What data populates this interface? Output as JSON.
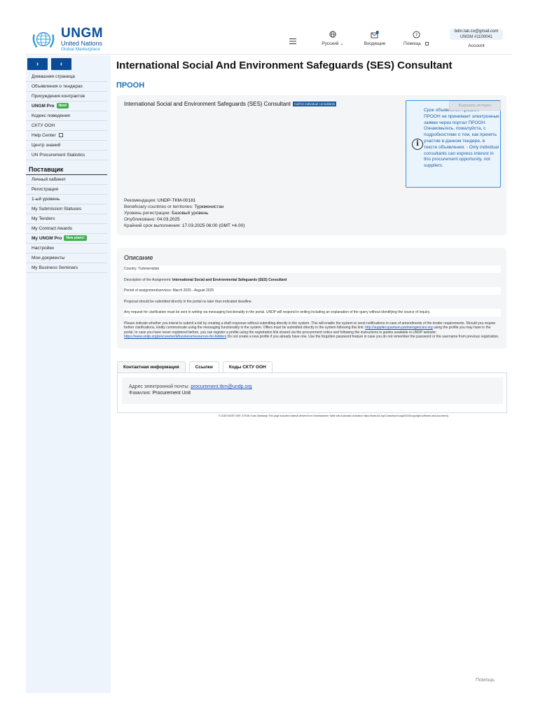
{
  "header": {
    "logo": {
      "title": "UNGM",
      "line1": "United Nations",
      "line2": "Global Marketplace"
    },
    "language_label": "Русский",
    "inbox_label": "Входящие",
    "help_label": "Помощь",
    "account_email": "bdm.tak.co@gmail.com",
    "account_id": "UNGM #1100041",
    "account_label": "Account"
  },
  "sidebar": {
    "items": [
      "Домашняя страница",
      "Объявления о тендерах",
      "Присуждения контрактов"
    ],
    "ungm_pro": "UNGM Pro",
    "new_badge": "New!",
    "items2": [
      "Кодекс поведения",
      "СКТУ ООН"
    ],
    "help_center": "Help Center",
    "items3": [
      "Центр знаний",
      "UN Procurement Statistics"
    ],
    "supplier_heading": "Поставщик",
    "supplier_items": [
      "Личный кабинет",
      "Регистрация",
      "1-ый уровень",
      "My Submission Statuses",
      "My Tenders",
      "My Contract Awards"
    ],
    "my_ungm_pro": "My UNGM Pro",
    "new_plans_badge": "New plans!",
    "supplier_items2": [
      "Настройки",
      "Мои документы",
      "My Business Seminars"
    ]
  },
  "main": {
    "title": "International Social And Environment Safeguards (SES) Consultant",
    "agency": "ПРООН",
    "card1": {
      "title": "International Social and Environment Safeguards (SES) Consultant",
      "tag": "Call for individual consultants",
      "express_button": "Выразить интерес",
      "notice": "Срок объявления прошел. - ПРООН не принимает электронные заявки через портал ПРООН. Ознакомьтесь, пожалуйста, с подробностями о том, как принять участие в данном тендере, в тексте объявления. - Only individual consultants can express interest in this procurement opportunity, not suppliers.",
      "ref_label": "Рекомендация:",
      "ref_value": "UNDP-TKM-00181",
      "countries_label": "Beneficiary countries or territories:",
      "countries_value": "Туркменистан",
      "level_label": "Уровень регистрации:",
      "level_value": "Базовый уровень",
      "published_label": "Опубликовано:",
      "published_value": "04.03.2025",
      "deadline_label": "Крайний срок выполнения:",
      "deadline_value": "17.03.2025 06:00 (GMT +4.00)"
    },
    "card2": {
      "title": "Описание",
      "country": "Country:   Turkmenistan",
      "assignment_label": "Description of the Assignment:",
      "assignment_value": "International Social and Environmental Safeguards (SES) Consultant",
      "period": "Period of assignment/services: March 2025 - August 2025",
      "proposal": "Proposal should be submitted directly in the portal no later than indicated deadline.",
      "clarification": "Any request for clarification must be sent in writing via messaging functionality in the portal. UNDP will respond in writing including an explanation of the query without identifying the source of inquiry.",
      "para1": "Please indicate whether you intend to submit a bid by creating a draft response without submitting directly in the system. This will enable the system to send notifications in case of amendments of the tender requirements. Should you require further clarifications, kindly communicate using the messaging functionality in the system. Offers must be submitted directly in the system following this link:",
      "link1": "http://supplier.quantum.partneragencies.org",
      "para2": "using the profile you may have in the portal. In case you have never registered before, you can register a profile using the registration link shared via the procurement notice and following the instructions in guides available in UNDP website:",
      "link2": "https://www.undp.org/procurement/business/resources-for-bidders",
      "para3": "Do not create a new profile if you already have one. Use the forgotten password feature in case you do not remember the password or the username from previous registration."
    },
    "tabs": [
      "Контактная информация",
      "Ссылки",
      "Коды СКТУ ООН"
    ],
    "contact": {
      "email_label": "Адрес электронной почты:",
      "email_value": "procurement.tkm@undp.org",
      "surname_label": "Фамилия:",
      "surname_value": "Procurement Unit"
    },
    "footer_note": "© 2025 NOOR OWT, 5 ROM, Kabi, Barbaraji: This page includes material derived from Dreamweaver Table with Automatic Activation https://www.w3.org/Consortium/Legal/2015/copyright-software-and-document).",
    "help_footer": "Помощь"
  }
}
